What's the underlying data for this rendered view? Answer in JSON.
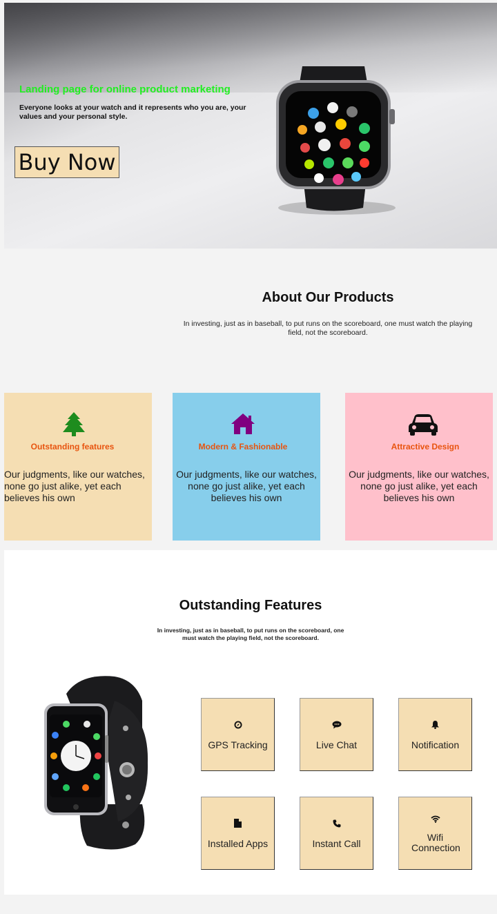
{
  "hero": {
    "title": "Landing page for online product marketing",
    "description": "Everyone looks at your watch and it represents who you are, your values and your personal style.",
    "button_label": "Buy Now"
  },
  "about": {
    "title": "About Our Products",
    "description": "In investing, just as in baseball, to put runs on the scoreboard, one must watch the playing field, not the scoreboard."
  },
  "cards": [
    {
      "title": "Outstanding features",
      "text": "Our judgments, like our watches, none go just alike, yet each believes his own",
      "icon": "tree-icon",
      "background": "#f5deb3",
      "icon_color": "#1e8c1e"
    },
    {
      "title": "Modern & Fashionable",
      "text": "Our judgments, like our watches, none go just alike, yet each believes his own",
      "icon": "home-icon",
      "background": "#87ceeb",
      "icon_color": "#800080"
    },
    {
      "title": "Attractive Design",
      "text": "Our judgments, like our watches, none go just alike, yet each believes his own",
      "icon": "car-icon",
      "background": "#ffc0cb",
      "icon_color": "#111111"
    }
  ],
  "features": {
    "title": "Outstanding Features",
    "description": "In investing, just as in baseball, to put runs on the scoreboard, one must watch the playing field, not the scoreboard.",
    "items": [
      {
        "label": "GPS Tracking",
        "icon": "compass-icon"
      },
      {
        "label": "Live Chat",
        "icon": "chat-icon"
      },
      {
        "label": "Notification",
        "icon": "bell-icon"
      },
      {
        "label": "Installed Apps",
        "icon": "file-icon"
      },
      {
        "label": "Instant Call",
        "icon": "phone-icon"
      },
      {
        "label": "Wifi Connection",
        "icon": "wifi-icon"
      }
    ]
  },
  "colors": {
    "hero_title": "#22ee22",
    "card_title": "#e8540f",
    "feature_box": "#f5deb3"
  }
}
